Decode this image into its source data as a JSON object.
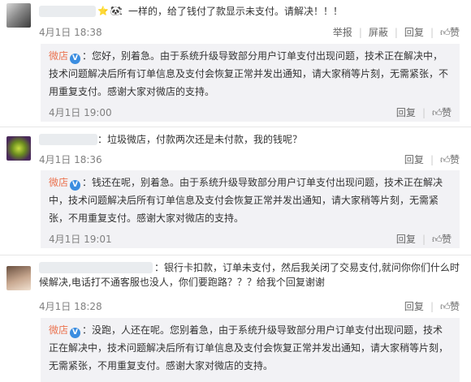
{
  "comments": [
    {
      "emoji": "⭐🐼",
      "text": "：一样的，给了钱付了款显示未支付。请解决！！！",
      "date": "4月1日",
      "time": "18:38",
      "actions": [
        "举报",
        "屏蔽",
        "回复"
      ],
      "like_label": "赞",
      "reply": {
        "name": "微店",
        "text": "：您好，别着急。由于系统升级导致部分用户订单支付出现问题，技术正在解决中，技术问题解决后所有订单信息及支付会恢复正常并发出通知，请大家稍等片刻，无需紧张，不用重复支付。感谢大家对微店的支持。",
        "date": "4月1日",
        "time": "19:00",
        "reply_label": "回复",
        "like_label": "赞"
      }
    },
    {
      "text": "：垃圾微店，付款两次还是未付款，我的钱呢？",
      "date": "4月1日",
      "time": "18:36",
      "reply_label": "回复",
      "like_label": "赞",
      "reply": {
        "name": "微店",
        "text": "：钱还在呢，别着急。由于系统升级导致部分用户订单支付出现问题，技术正在解决中，技术问题解决后所有订单信息及支付会恢复正常并发出通知，请大家稍等片刻，无需紧张，不用重复支付。感谢大家对微店的支持。",
        "date": "4月1日",
        "time": "19:01",
        "reply_label": "回复",
        "like_label": "赞"
      }
    },
    {
      "text": "：银行卡扣款，订单未支付，然后我关闭了交易支付,就问你你们什么时候解决,电话打不通客服也没人，你们要跑路？？？给我个回复谢谢",
      "date": "4月1日",
      "time": "18:28",
      "reply_label": "回复",
      "like_label": "赞",
      "reply": {
        "name": "微店",
        "text": "：没跑，人还在呢。您别着急，由于系统升级导致部分用户订单支付出现问题，技术正在解决中，技术问题解决后所有订单信息及支付会恢复正常并发出通知，请大家稍等片刻，无需紧张，不用重复支付。感谢大家对微店的支持。"
      }
    }
  ]
}
